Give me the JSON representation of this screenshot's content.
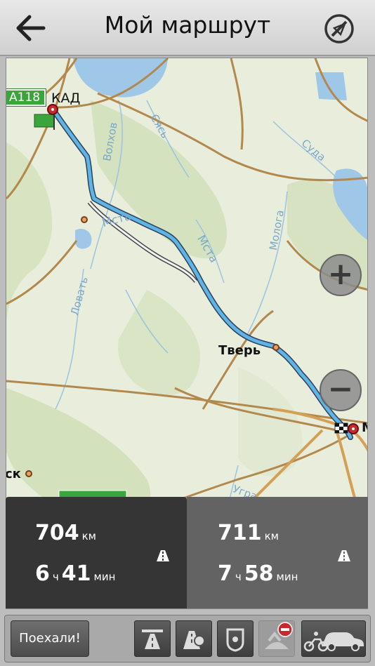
{
  "header": {
    "title": "Мой маршрут"
  },
  "map": {
    "road_badge": "A118",
    "labels": {
      "kad": "КАД",
      "tver": "Тверь",
      "volkhov": "Волхов",
      "sas": "Сясь",
      "suda": "Суда",
      "msta1": "Мста",
      "msta2": "Мста",
      "mologa": "Молога",
      "lovat": "Ловать",
      "ugra": "Угра",
      "sk": "ск",
      "m": "М"
    }
  },
  "routes": [
    {
      "distance": "704",
      "distance_unit": "км",
      "hours": "6",
      "hours_unit": "ч",
      "minutes": "41",
      "minutes_unit": "мин"
    },
    {
      "distance": "711",
      "distance_unit": "км",
      "hours": "7",
      "hours_unit": "ч",
      "minutes": "58",
      "minutes_unit": "мин"
    }
  ],
  "toolbar": {
    "go_label": "Поехали!"
  },
  "colors": {
    "route": "#5fb4e6",
    "panel_active": "#353535",
    "panel_inactive": "#636363"
  }
}
